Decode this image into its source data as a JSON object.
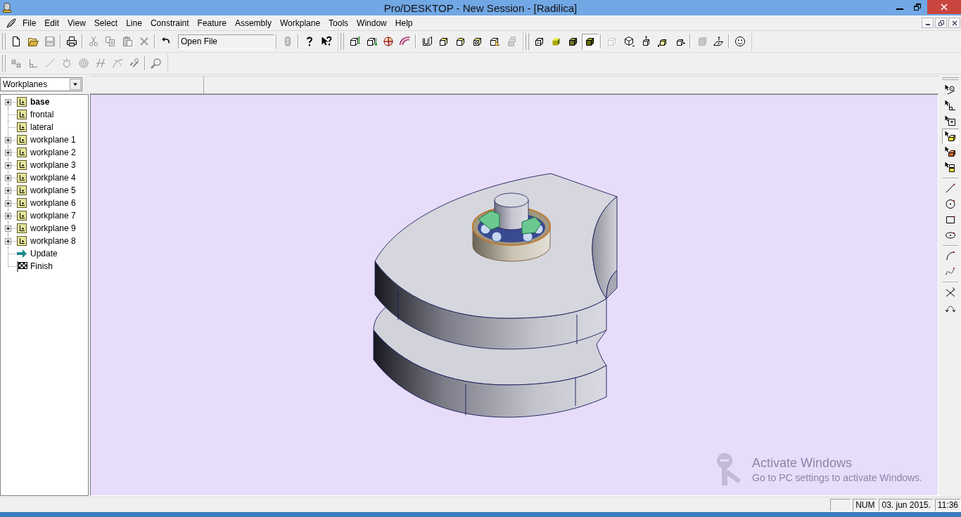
{
  "window": {
    "title": "Pro/DESKTOP - New Session - [Radilica]"
  },
  "menu_bar": [
    "File",
    "Edit",
    "View",
    "Select",
    "Line",
    "Constraint",
    "Feature",
    "Assembly",
    "Workplane",
    "Tools",
    "Window",
    "Help"
  ],
  "toolbar_rows": [
    {
      "toolbars": [
        {
          "groups": [
            [
              {
                "kind": "new",
                "disabled": false
              },
              {
                "kind": "open",
                "disabled": false
              },
              {
                "kind": "save",
                "disabled": true
              }
            ],
            [
              {
                "kind": "print",
                "disabled": false
              }
            ],
            [
              {
                "kind": "cut",
                "disabled": true
              },
              {
                "kind": "copy",
                "disabled": true
              },
              {
                "kind": "paste",
                "disabled": true
              },
              {
                "kind": "delete",
                "disabled": true
              }
            ],
            [
              {
                "kind": "undo",
                "disabled": false
              },
              {
                "kind": "field",
                "value": "Open File",
                "disabled": false
              }
            ],
            [
              {
                "kind": "figure",
                "disabled": true
              }
            ],
            [
              {
                "kind": "help",
                "disabled": false
              },
              {
                "kind": "pointerhelp",
                "disabled": false
              }
            ]
          ]
        },
        {
          "groups": [
            [
              {
                "kind": "extrude",
                "disabled": false
              },
              {
                "kind": "project",
                "disabled": false
              },
              {
                "kind": "revolve",
                "disabled": false
              },
              {
                "kind": "sweep",
                "disabled": false
              }
            ],
            [
              {
                "kind": "shell",
                "disabled": false
              },
              {
                "kind": "block",
                "disabled": false
              },
              {
                "kind": "chamfer",
                "disabled": false
              },
              {
                "kind": "frame",
                "disabled": false
              },
              {
                "kind": "taper",
                "disabled": false
              },
              {
                "kind": "stack",
                "disabled": true
              }
            ]
          ]
        },
        {
          "groups": [
            [
              {
                "kind": "wireframe",
                "disabled": false,
                "pressed": false
              },
              {
                "kind": "shaded",
                "disabled": false,
                "pressed": false
              },
              {
                "kind": "darkshaded",
                "disabled": false,
                "pressed": false
              },
              {
                "kind": "solid",
                "disabled": false,
                "pressed": true
              }
            ],
            [
              {
                "kind": "ghost",
                "disabled": true
              },
              {
                "kind": "isometric",
                "disabled": false
              },
              {
                "kind": "lift",
                "disabled": false
              },
              {
                "kind": "drop",
                "disabled": false
              },
              {
                "kind": "shift",
                "disabled": false
              }
            ],
            [
              {
                "kind": "layer",
                "disabled": true
              },
              {
                "kind": "plane",
                "disabled": false
              }
            ],
            [
              {
                "kind": "smiley",
                "disabled": false
              }
            ]
          ]
        }
      ]
    },
    {
      "toolbars": [
        {
          "groups": [
            [
              {
                "kind": "dimension",
                "disabled": true
              },
              {
                "kind": "angle",
                "disabled": true
              },
              {
                "kind": "diagonal",
                "disabled": true
              },
              {
                "kind": "gearcircle",
                "disabled": true
              },
              {
                "kind": "concentric",
                "disabled": true
              },
              {
                "kind": "parallel",
                "disabled": true
              },
              {
                "kind": "tangent",
                "disabled": true
              },
              {
                "kind": "link",
                "disabled": true
              }
            ],
            [
              {
                "kind": "zoom",
                "disabled": true
              }
            ]
          ]
        }
      ]
    }
  ],
  "sidebar": {
    "selector": {
      "value": "Workplanes"
    },
    "tree": [
      {
        "label": "base",
        "kind": "workplane",
        "expandable": true,
        "active": true
      },
      {
        "label": "frontal",
        "kind": "workplane",
        "expandable": false,
        "active": false
      },
      {
        "label": "lateral",
        "kind": "workplane",
        "expandable": false,
        "active": false
      },
      {
        "label": "workplane 1",
        "kind": "workplane",
        "expandable": true,
        "active": false
      },
      {
        "label": "workplane 2",
        "kind": "workplane",
        "expandable": true,
        "active": false
      },
      {
        "label": "workplane 3",
        "kind": "workplane",
        "expandable": true,
        "active": false
      },
      {
        "label": "workplane 4",
        "kind": "workplane",
        "expandable": true,
        "active": false
      },
      {
        "label": "workplane 5",
        "kind": "workplane",
        "expandable": true,
        "active": false
      },
      {
        "label": "workplane 6",
        "kind": "workplane",
        "expandable": true,
        "active": false
      },
      {
        "label": "workplane 7",
        "kind": "workplane",
        "expandable": true,
        "active": false
      },
      {
        "label": "workplane 9",
        "kind": "workplane",
        "expandable": true,
        "active": false
      },
      {
        "label": "workplane 8",
        "kind": "workplane",
        "expandable": true,
        "active": false
      },
      {
        "label": "Update",
        "kind": "update",
        "expandable": false,
        "active": false
      },
      {
        "label": "Finish",
        "kind": "finish",
        "expandable": false,
        "active": false
      }
    ]
  },
  "viewport": {
    "notice": {
      "title": "Activate Windows",
      "text": "Go to PC settings to activate Windows."
    }
  },
  "side_toolbar": {
    "groups": [
      [
        {
          "kind": "pickpoint",
          "pressed": false
        },
        {
          "kind": "pickangle",
          "pressed": false
        },
        {
          "kind": "pickplane",
          "pressed": false
        },
        {
          "kind": "pickface",
          "pressed": true
        },
        {
          "kind": "pickbody",
          "pressed": false
        },
        {
          "kind": "pickfeature",
          "pressed": false
        }
      ],
      [
        {
          "kind": "line",
          "pressed": false
        },
        {
          "kind": "circle",
          "pressed": false
        },
        {
          "kind": "rectangle",
          "pressed": false
        },
        {
          "kind": "ellipse",
          "pressed": false
        }
      ],
      [
        {
          "kind": "arc",
          "pressed": false
        },
        {
          "kind": "spline",
          "pressed": false
        }
      ],
      [
        {
          "kind": "trim",
          "pressed": false
        },
        {
          "kind": "bend",
          "pressed": false
        }
      ]
    ]
  },
  "status_bar": {
    "panes": [
      "NUM",
      "03. jun 2015.",
      "11:36"
    ]
  }
}
